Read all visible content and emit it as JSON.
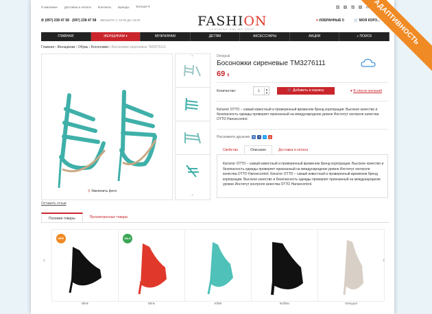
{
  "ribbon": "АДАПТИВНОСТЬ",
  "topbar": {
    "links": [
      "О магазине",
      "Доставка и оплата",
      "Контакты",
      "Бренды",
      "Больше ▾"
    ],
    "social": [
      "B",
      "f",
      "g+",
      "t"
    ],
    "login": "Войти в магазин"
  },
  "header": {
    "phone1": "(097) 238 47 58",
    "phone2": "(097) 238 47 58",
    "callhours": "ЗВОНИТЕ С 10:00 ДО 18:00",
    "logo_main": "FASHI",
    "logo_accent": "ON",
    "logo_sub": "CLOTHING ONLINE SHOP",
    "favorites": "ИЗБРАННЫЕ",
    "favorites_count": "0",
    "cart": "МОЯ КОРЗ..."
  },
  "nav": [
    "ГЛАВНАЯ",
    "ЖЕНЩИНАМ ▾",
    "МУЖЧИНАМ",
    "ДЕТЯМ",
    "АКСЕССУАРЫ",
    "АКЦИИ",
    "ПОИСК"
  ],
  "breadcrumb": {
    "items": [
      "Главная",
      "Женщинам",
      "Обувь",
      "Босоножки"
    ],
    "current": "Босоножки сиреневые ТМ3276111",
    "sep": " › "
  },
  "gallery": {
    "zoom": "Увеличить фото"
  },
  "product": {
    "brand": "Desigual",
    "title": "Босоножки сиреневые ТМ3276111",
    "price": "69",
    "currency": "$",
    "qty_label": "Количество:",
    "qty": "1",
    "add_cart": "Добавить в корзину",
    "wishlist": "В список желаний",
    "description": "Каталог ОТТО – самый известный и проверенный временем бренд корпорации. Высокое качество и безопасность одежды проверяет признанный на международном уровне Институт контроля качества ОТТО Hansecontrol.",
    "share_label": "Расскажите друзьям:"
  },
  "product_tabs": [
    "Свойства",
    "Описание",
    "Доставка и оплата"
  ],
  "tab_content": "Каталог ОТТО – самый известный и проверенный временем бренд корпорации. Высокое качество и безопасность одежды проверяет признанный на международном уровне Институт контроля качества ОТТО Hansecontrol. Каталог ОТТО – самый известный и проверенный временем бренд корпорации. Высокое качество и безопасность одежды проверяет признанный на международном уровне Институт контроля качества ОТТО Hansecontrol.",
  "review_link": "Оставить отзыв",
  "bottom_tabs": [
    "Похожие товары",
    "Просмотренные товары"
  ],
  "carousel": {
    "cards": [
      {
        "badge": "NEW",
        "badge_color": "#f08a24",
        "name": "Blink",
        "color": "#111"
      },
      {
        "badge": "SALE",
        "badge_color": "#3aa655",
        "name": "Blink",
        "color": "#e0392b"
      },
      {
        "badge": "",
        "badge_color": "",
        "name": "Killah",
        "color": "#4fc1b9"
      },
      {
        "badge": "",
        "badge_color": "",
        "name": "Buffalo",
        "color": "#111"
      },
      {
        "badge": "",
        "badge_color": "",
        "name": "Desigual",
        "color": "#d8cfc6"
      }
    ]
  },
  "colors": {
    "accent": "#c9252b",
    "nav_bg": "#222222",
    "ribbon": "#f08a24",
    "page_bg": "#e9f3f8"
  }
}
